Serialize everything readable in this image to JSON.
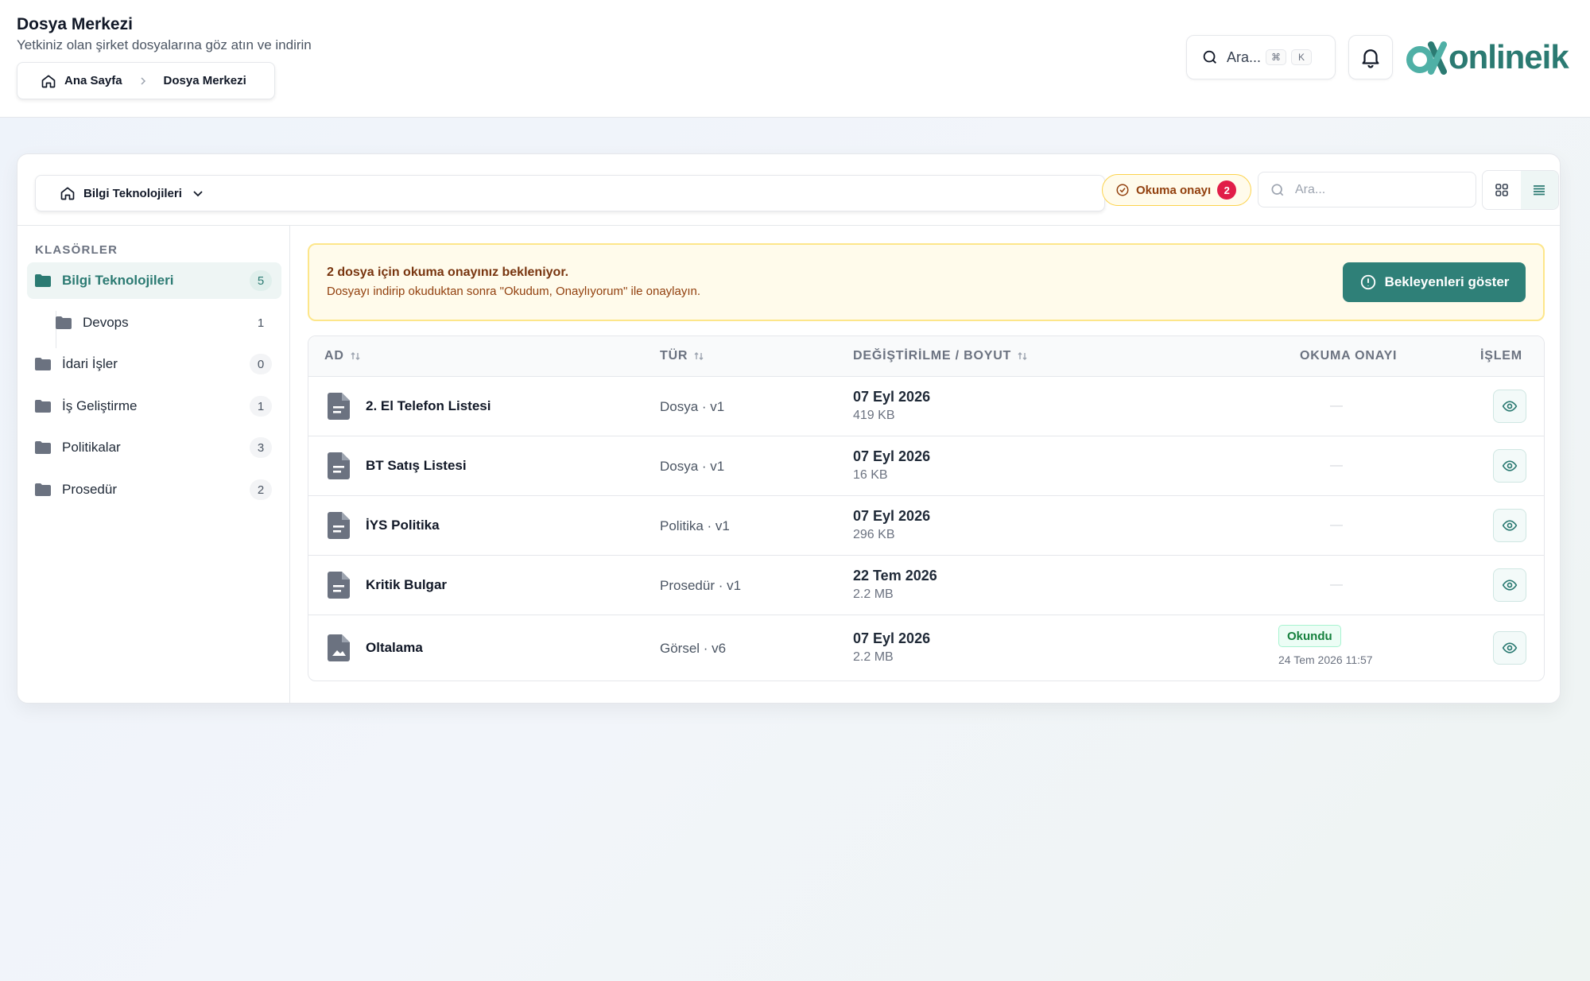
{
  "header": {
    "title": "Dosya Merkezi",
    "subtitle": "Yetkiniz olan şirket dosyalarına göz atın ve indirin",
    "breadcrumb": [
      "Ana Sayfa",
      "Dosya Merkezi"
    ],
    "search_placeholder": "Ara...",
    "shortcut_keys": [
      "⌘",
      "K"
    ],
    "logo_text": "onlineik"
  },
  "toolbar": {
    "current_folder": "Bilgi Teknolojileri",
    "read_approval_label": "Okuma onayı",
    "read_approval_count": "2",
    "search_placeholder": "Ara...",
    "view_modes": [
      "grid",
      "list"
    ],
    "active_view": "list"
  },
  "sidebar": {
    "heading": "KLASÖRLER",
    "items": [
      {
        "label": "Bilgi Teknolojileri",
        "count": "5",
        "active": true
      },
      {
        "label": "Devops",
        "count": "1",
        "sub": true
      },
      {
        "label": "İdari İşler",
        "count": "0"
      },
      {
        "label": "İş Geliştirme",
        "count": "1"
      },
      {
        "label": "Politikalar",
        "count": "3"
      },
      {
        "label": "Prosedür",
        "count": "2"
      }
    ]
  },
  "alert": {
    "title": "2 dosya için okuma onayınız bekleniyor.",
    "text": "Dosyayı indirip okuduktan sonra \"Okudum, Onaylıyorum\" ile onaylayın.",
    "button": "Bekleyenleri göster"
  },
  "table": {
    "columns": {
      "name": "AD",
      "type": "TÜR",
      "modified": "DEĞİŞTİRİLME / BOYUT",
      "read": "OKUMA ONAYI",
      "action": "İŞLEM"
    },
    "rows": [
      {
        "name": "2. El Telefon Listesi",
        "type": "Dosya · v1",
        "date": "07 Eyl 2026",
        "size": "419 KB",
        "read": "—",
        "icon": "file-doc-icon"
      },
      {
        "name": "BT Satış Listesi",
        "type": "Dosya · v1",
        "date": "07 Eyl 2026",
        "size": "16 KB",
        "read": "—",
        "icon": "file-doc-icon"
      },
      {
        "name": "İYS Politika",
        "type": "Politika · v1",
        "date": "07 Eyl 2026",
        "size": "296 KB",
        "read": "—",
        "icon": "file-doc-icon"
      },
      {
        "name": "Kritik Bulgar",
        "type": "Prosedür · v1",
        "date": "22 Tem 2026",
        "size": "2.2 MB",
        "read": "—",
        "icon": "file-doc-icon"
      },
      {
        "name": "Oltalama",
        "type": "Görsel · v6",
        "date": "07 Eyl 2026",
        "size": "2.2 MB",
        "read_badge": "Okundu",
        "read_date": "24 Tem 2026 11:57",
        "icon": "file-image-icon"
      }
    ]
  },
  "colors": {
    "brand": "#2b7a72",
    "warning_bg": "#fffbeb",
    "danger": "#e11d48"
  }
}
